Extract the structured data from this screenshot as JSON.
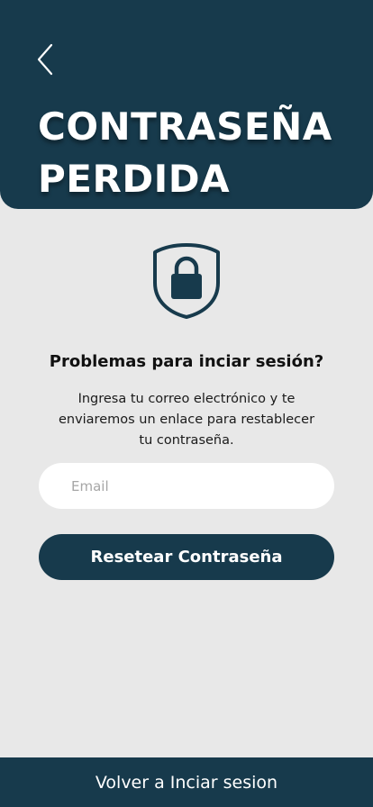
{
  "header": {
    "back_icon": "chevron-left-icon",
    "title_line1": "CONTRASEÑA",
    "title_line2": "PERDIDA"
  },
  "hero": {
    "icon": "shield-lock-icon"
  },
  "content": {
    "heading": "Problemas para inciar sesión?",
    "description": "Ingresa tu correo electrónico y te enviaremos un enlace para restablecer tu contraseña."
  },
  "form": {
    "email_placeholder": "Email",
    "email_value": "",
    "reset_label": "Resetear Contraseña"
  },
  "footer": {
    "link_label": "Volver a Inciar sesion"
  },
  "colors": {
    "primary": "#173a4c",
    "background": "#e8e8e8",
    "input_background": "#ffffff"
  }
}
